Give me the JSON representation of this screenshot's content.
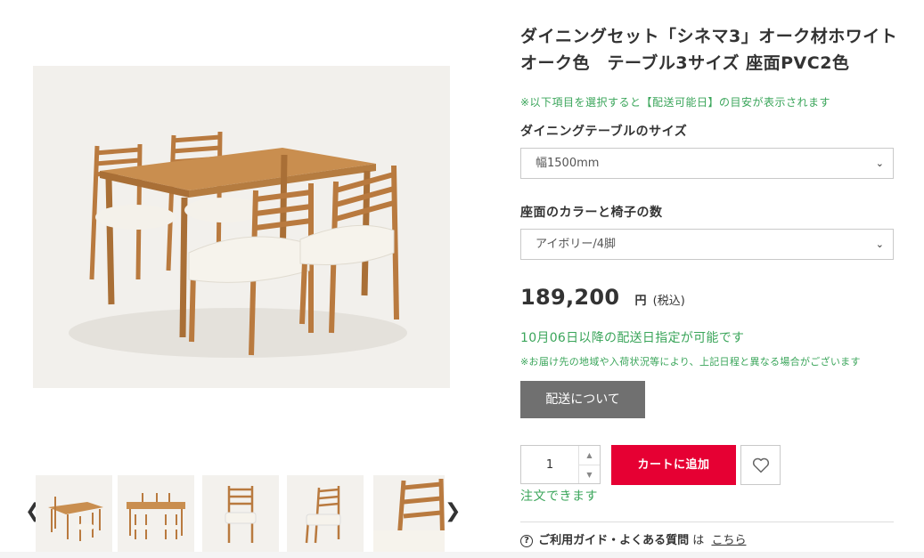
{
  "product": {
    "title": "ダイニングセット「シネマ3」オーク材ホワイトオーク色　テーブル3サイズ 座面PVC2色"
  },
  "notice": "※以下項目を選択すると【配送可能日】の目安が表示されます",
  "options": [
    {
      "label": "ダイニングテーブルのサイズ",
      "selected": "幅1500mm"
    },
    {
      "label": "座面のカラーと椅子の数",
      "selected": "アイボリー/4脚"
    }
  ],
  "price": {
    "amount": "189,200",
    "currency": "円",
    "tax_note": "(税込)"
  },
  "delivery": {
    "date_text": "10月06日以降の配送日指定が可能です",
    "note": "※お届け先の地域や入荷状況等により、上記日程と異なる場合がございます",
    "button_label": "配送について"
  },
  "purchase": {
    "quantity": "1",
    "cart_label": "カートに追加",
    "order_status": "注文できます"
  },
  "guide": {
    "text": "ご利用ガイド・よくある質問",
    "particle": "は",
    "link": "こちら"
  },
  "gallery": {
    "thumbnail_count": 5,
    "prev_icon": "chevron-left-icon",
    "next_icon": "chevron-right-icon"
  },
  "colors": {
    "accent_red": "#e60033",
    "notice_green": "#3aa55a",
    "gray_button": "#707070"
  }
}
